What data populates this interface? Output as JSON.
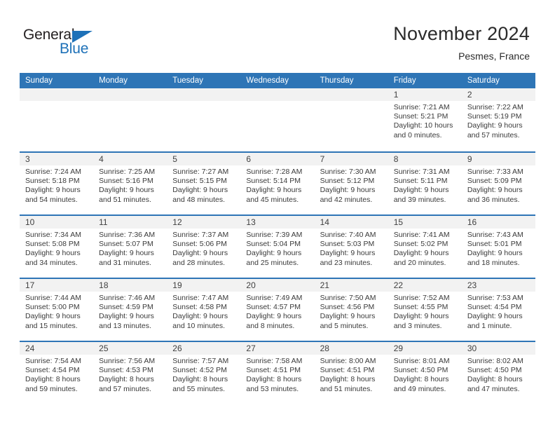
{
  "brand": {
    "word_one": "General",
    "word_two": "Blue",
    "triangle_color": "#1e71b8"
  },
  "header": {
    "title": "November 2024",
    "location": "Pesmes, France"
  },
  "theme": {
    "header_blue": "#2e75b6",
    "daynum_band": "#f2f2f2",
    "text": "#3a3a3a"
  },
  "calendar": {
    "weekday_headers": [
      "Sunday",
      "Monday",
      "Tuesday",
      "Wednesday",
      "Thursday",
      "Friday",
      "Saturday"
    ],
    "labels": {
      "sunrise": "Sunrise:",
      "sunset": "Sunset:",
      "daylight": "Daylight:"
    },
    "weeks": [
      [
        {
          "day": ""
        },
        {
          "day": ""
        },
        {
          "day": ""
        },
        {
          "day": ""
        },
        {
          "day": ""
        },
        {
          "day": "1",
          "sunrise": "Sunrise: 7:21 AM",
          "sunset": "Sunset: 5:21 PM",
          "daylight_1": "Daylight: 10 hours",
          "daylight_2": "and 0 minutes."
        },
        {
          "day": "2",
          "sunrise": "Sunrise: 7:22 AM",
          "sunset": "Sunset: 5:19 PM",
          "daylight_1": "Daylight: 9 hours",
          "daylight_2": "and 57 minutes."
        }
      ],
      [
        {
          "day": "3",
          "sunrise": "Sunrise: 7:24 AM",
          "sunset": "Sunset: 5:18 PM",
          "daylight_1": "Daylight: 9 hours",
          "daylight_2": "and 54 minutes."
        },
        {
          "day": "4",
          "sunrise": "Sunrise: 7:25 AM",
          "sunset": "Sunset: 5:16 PM",
          "daylight_1": "Daylight: 9 hours",
          "daylight_2": "and 51 minutes."
        },
        {
          "day": "5",
          "sunrise": "Sunrise: 7:27 AM",
          "sunset": "Sunset: 5:15 PM",
          "daylight_1": "Daylight: 9 hours",
          "daylight_2": "and 48 minutes."
        },
        {
          "day": "6",
          "sunrise": "Sunrise: 7:28 AM",
          "sunset": "Sunset: 5:14 PM",
          "daylight_1": "Daylight: 9 hours",
          "daylight_2": "and 45 minutes."
        },
        {
          "day": "7",
          "sunrise": "Sunrise: 7:30 AM",
          "sunset": "Sunset: 5:12 PM",
          "daylight_1": "Daylight: 9 hours",
          "daylight_2": "and 42 minutes."
        },
        {
          "day": "8",
          "sunrise": "Sunrise: 7:31 AM",
          "sunset": "Sunset: 5:11 PM",
          "daylight_1": "Daylight: 9 hours",
          "daylight_2": "and 39 minutes."
        },
        {
          "day": "9",
          "sunrise": "Sunrise: 7:33 AM",
          "sunset": "Sunset: 5:09 PM",
          "daylight_1": "Daylight: 9 hours",
          "daylight_2": "and 36 minutes."
        }
      ],
      [
        {
          "day": "10",
          "sunrise": "Sunrise: 7:34 AM",
          "sunset": "Sunset: 5:08 PM",
          "daylight_1": "Daylight: 9 hours",
          "daylight_2": "and 34 minutes."
        },
        {
          "day": "11",
          "sunrise": "Sunrise: 7:36 AM",
          "sunset": "Sunset: 5:07 PM",
          "daylight_1": "Daylight: 9 hours",
          "daylight_2": "and 31 minutes."
        },
        {
          "day": "12",
          "sunrise": "Sunrise: 7:37 AM",
          "sunset": "Sunset: 5:06 PM",
          "daylight_1": "Daylight: 9 hours",
          "daylight_2": "and 28 minutes."
        },
        {
          "day": "13",
          "sunrise": "Sunrise: 7:39 AM",
          "sunset": "Sunset: 5:04 PM",
          "daylight_1": "Daylight: 9 hours",
          "daylight_2": "and 25 minutes."
        },
        {
          "day": "14",
          "sunrise": "Sunrise: 7:40 AM",
          "sunset": "Sunset: 5:03 PM",
          "daylight_1": "Daylight: 9 hours",
          "daylight_2": "and 23 minutes."
        },
        {
          "day": "15",
          "sunrise": "Sunrise: 7:41 AM",
          "sunset": "Sunset: 5:02 PM",
          "daylight_1": "Daylight: 9 hours",
          "daylight_2": "and 20 minutes."
        },
        {
          "day": "16",
          "sunrise": "Sunrise: 7:43 AM",
          "sunset": "Sunset: 5:01 PM",
          "daylight_1": "Daylight: 9 hours",
          "daylight_2": "and 18 minutes."
        }
      ],
      [
        {
          "day": "17",
          "sunrise": "Sunrise: 7:44 AM",
          "sunset": "Sunset: 5:00 PM",
          "daylight_1": "Daylight: 9 hours",
          "daylight_2": "and 15 minutes."
        },
        {
          "day": "18",
          "sunrise": "Sunrise: 7:46 AM",
          "sunset": "Sunset: 4:59 PM",
          "daylight_1": "Daylight: 9 hours",
          "daylight_2": "and 13 minutes."
        },
        {
          "day": "19",
          "sunrise": "Sunrise: 7:47 AM",
          "sunset": "Sunset: 4:58 PM",
          "daylight_1": "Daylight: 9 hours",
          "daylight_2": "and 10 minutes."
        },
        {
          "day": "20",
          "sunrise": "Sunrise: 7:49 AM",
          "sunset": "Sunset: 4:57 PM",
          "daylight_1": "Daylight: 9 hours",
          "daylight_2": "and 8 minutes."
        },
        {
          "day": "21",
          "sunrise": "Sunrise: 7:50 AM",
          "sunset": "Sunset: 4:56 PM",
          "daylight_1": "Daylight: 9 hours",
          "daylight_2": "and 5 minutes."
        },
        {
          "day": "22",
          "sunrise": "Sunrise: 7:52 AM",
          "sunset": "Sunset: 4:55 PM",
          "daylight_1": "Daylight: 9 hours",
          "daylight_2": "and 3 minutes."
        },
        {
          "day": "23",
          "sunrise": "Sunrise: 7:53 AM",
          "sunset": "Sunset: 4:54 PM",
          "daylight_1": "Daylight: 9 hours",
          "daylight_2": "and 1 minute."
        }
      ],
      [
        {
          "day": "24",
          "sunrise": "Sunrise: 7:54 AM",
          "sunset": "Sunset: 4:54 PM",
          "daylight_1": "Daylight: 8 hours",
          "daylight_2": "and 59 minutes."
        },
        {
          "day": "25",
          "sunrise": "Sunrise: 7:56 AM",
          "sunset": "Sunset: 4:53 PM",
          "daylight_1": "Daylight: 8 hours",
          "daylight_2": "and 57 minutes."
        },
        {
          "day": "26",
          "sunrise": "Sunrise: 7:57 AM",
          "sunset": "Sunset: 4:52 PM",
          "daylight_1": "Daylight: 8 hours",
          "daylight_2": "and 55 minutes."
        },
        {
          "day": "27",
          "sunrise": "Sunrise: 7:58 AM",
          "sunset": "Sunset: 4:51 PM",
          "daylight_1": "Daylight: 8 hours",
          "daylight_2": "and 53 minutes."
        },
        {
          "day": "28",
          "sunrise": "Sunrise: 8:00 AM",
          "sunset": "Sunset: 4:51 PM",
          "daylight_1": "Daylight: 8 hours",
          "daylight_2": "and 51 minutes."
        },
        {
          "day": "29",
          "sunrise": "Sunrise: 8:01 AM",
          "sunset": "Sunset: 4:50 PM",
          "daylight_1": "Daylight: 8 hours",
          "daylight_2": "and 49 minutes."
        },
        {
          "day": "30",
          "sunrise": "Sunrise: 8:02 AM",
          "sunset": "Sunset: 4:50 PM",
          "daylight_1": "Daylight: 8 hours",
          "daylight_2": "and 47 minutes."
        }
      ]
    ]
  }
}
